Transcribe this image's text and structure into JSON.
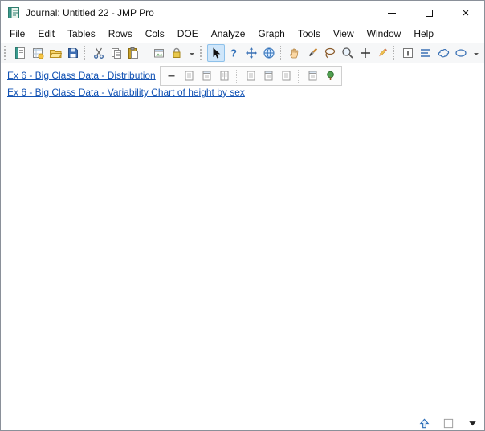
{
  "window": {
    "title": "Journal: Untitled 22 - JMP Pro",
    "controls": {
      "minimize": "minimize",
      "maximize": "maximize",
      "close": "close"
    }
  },
  "menubar": {
    "items": [
      "File",
      "Edit",
      "Tables",
      "Rows",
      "Cols",
      "DOE",
      "Analyze",
      "Graph",
      "Tools",
      "View",
      "Window",
      "Help"
    ]
  },
  "toolbar": {
    "file_group": [
      "new-journal",
      "new-data-table",
      "open",
      "save"
    ],
    "clipboard_group": [
      "cut",
      "copy",
      "paste"
    ],
    "misc_group": [
      "copy-picture",
      "lock"
    ],
    "tools_group": [
      "arrow",
      "help",
      "move",
      "internet-open",
      "grabber",
      "brush",
      "lasso",
      "magnifier",
      "crosshair",
      "annotate",
      "text",
      "lines",
      "polygon",
      "oval"
    ],
    "selected_tool": "arrow"
  },
  "journal": {
    "links": [
      "Ex 6 - Big Class Data - Distribution",
      "Ex 6 - Big Class Data - Variability Chart of height by sex"
    ],
    "hover_toolbar_icons": [
      "collapse",
      "page-plain",
      "page-header",
      "page-columns",
      "page-plain",
      "page-header",
      "page-plain",
      "page-header",
      "tree"
    ]
  },
  "statusbar": {
    "icons": [
      "up-arrow",
      "window-box",
      "dropdown"
    ]
  },
  "colors": {
    "link": "#1353b4",
    "tool_selected_bg": "#cfe6fa",
    "tool_selected_border": "#8ec1ea"
  }
}
